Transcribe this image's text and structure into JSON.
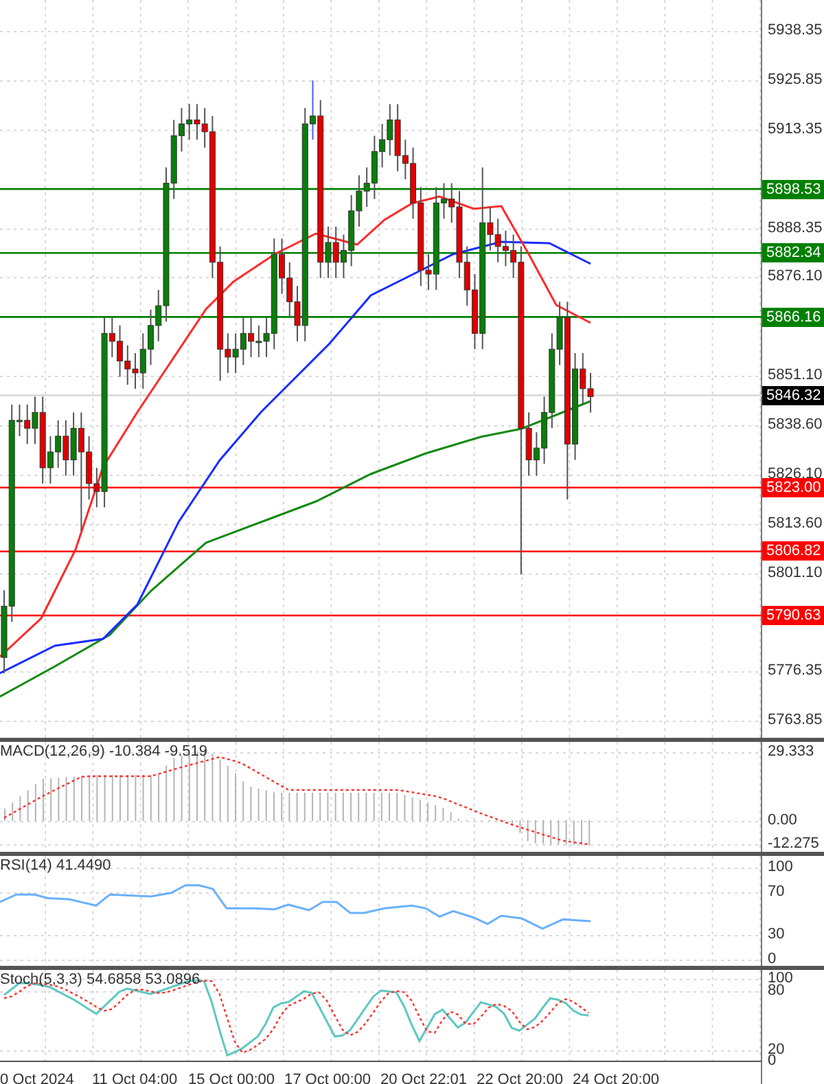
{
  "price_axis": {
    "labels": [
      "5938.35",
      "5925.85",
      "5913.35",
      "5888.35",
      "5876.10",
      "5851.10",
      "5838.60",
      "5826.10",
      "5813.60",
      "5801.10",
      "5776.35",
      "5763.85"
    ]
  },
  "levels": [
    {
      "price": "5898.53",
      "color": "#008000"
    },
    {
      "price": "5882.34",
      "color": "#008000"
    },
    {
      "price": "5866.16",
      "color": "#008000"
    },
    {
      "price": "5823.00",
      "color": "#ff0000"
    },
    {
      "price": "5806.82",
      "color": "#ff0000"
    },
    {
      "price": "5790.63",
      "color": "#ff0000"
    }
  ],
  "current_price": {
    "price": "5846.32"
  },
  "indicators": [
    {
      "kind": "macd",
      "label": "MACD(12,26,9) -10.384 -9.519",
      "axis": [
        "29.333",
        "0.00",
        "-12.275"
      ]
    },
    {
      "kind": "rsi",
      "label": "RSI(14) 41.4490",
      "axis": [
        "100",
        "70",
        "30",
        "0"
      ]
    },
    {
      "kind": "stoch",
      "label": "Stoch(5,3,3) 54.6858 53.0896",
      "axis": [
        "100",
        "80",
        "20",
        "0"
      ]
    }
  ],
  "time_axis": {
    "labels": [
      "0 Oct 2024",
      "11 Oct 04:00",
      "15 Oct 00:00",
      "17 Oct 00:00",
      "20 Oct 22:01",
      "22 Oct 20:00",
      "24 Oct 20:00"
    ]
  }
}
